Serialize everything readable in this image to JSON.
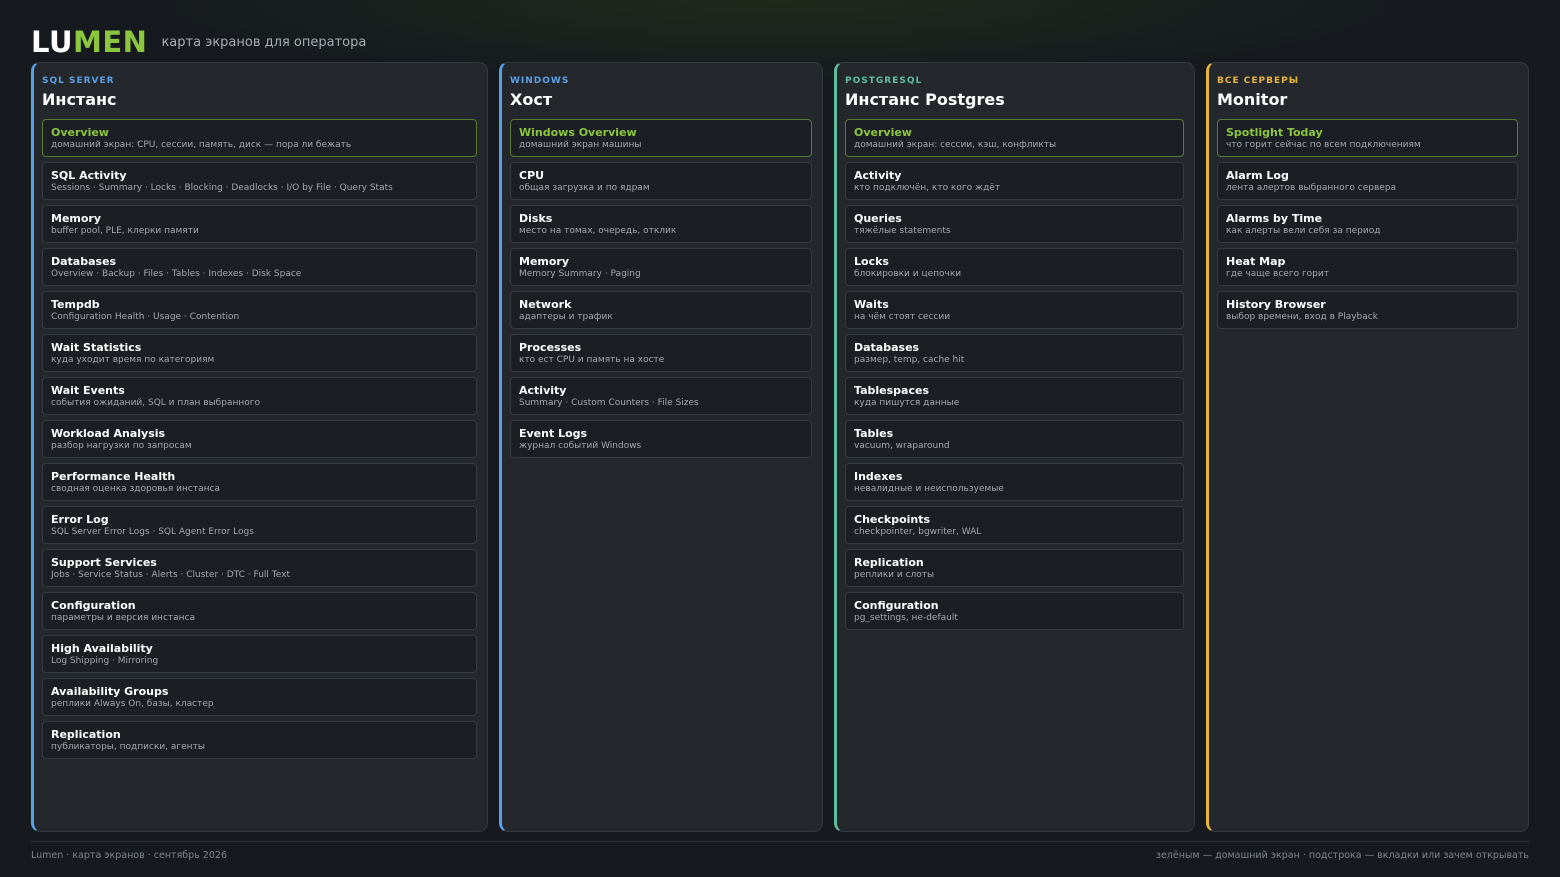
{
  "header": {
    "logo_a": "LU",
    "logo_b": "MEN",
    "subtitle": "карта экранов для оператора"
  },
  "colors": {
    "sql": "#5aa0e6",
    "windows": "#5aa0e6",
    "postgres": "#5fbf9a",
    "all": "#e6b53c",
    "home": "#8cc63f"
  },
  "panels": [
    {
      "category": "SQL SERVER",
      "title": "Инстанс",
      "items": [
        {
          "name": "Overview",
          "desc": "домашний экран: CPU, сессии, память, диск — пора ли бежать",
          "home": true
        },
        {
          "name": "SQL Activity",
          "desc": "Sessions · Summary · Locks · Blocking · Deadlocks · I/O by File · Query Stats"
        },
        {
          "name": "Memory",
          "desc": "buffer pool, PLE, клерки памяти"
        },
        {
          "name": "Databases",
          "desc": "Overview · Backup · Files · Tables · Indexes · Disk Space"
        },
        {
          "name": "Tempdb",
          "desc": "Configuration Health · Usage · Contention"
        },
        {
          "name": "Wait Statistics",
          "desc": "куда уходит время по категориям"
        },
        {
          "name": "Wait Events",
          "desc": "события ожиданий, SQL и план выбранного"
        },
        {
          "name": "Workload Analysis",
          "desc": "разбор нагрузки по запросам"
        },
        {
          "name": "Performance Health",
          "desc": "сводная оценка здоровья инстанса"
        },
        {
          "name": "Error Log",
          "desc": "SQL Server Error Logs · SQL Agent Error Logs"
        },
        {
          "name": "Support Services",
          "desc": "Jobs · Service Status · Alerts · Cluster · DTC · Full Text"
        },
        {
          "name": "Configuration",
          "desc": "параметры и версия инстанса"
        },
        {
          "name": "High Availability",
          "desc": "Log Shipping · Mirroring"
        },
        {
          "name": "Availability Groups",
          "desc": "реплики Always On, базы, кластер"
        },
        {
          "name": "Replication",
          "desc": "публикаторы, подписки, агенты"
        }
      ]
    },
    {
      "category": "WINDOWS",
      "title": "Хост",
      "items": [
        {
          "name": "Windows Overview",
          "desc": "домашний экран машины",
          "home": true
        },
        {
          "name": "CPU",
          "desc": "общая загрузка и по ядрам"
        },
        {
          "name": "Disks",
          "desc": "место на томах, очередь, отклик"
        },
        {
          "name": "Memory",
          "desc": "Memory Summary · Paging"
        },
        {
          "name": "Network",
          "desc": "адаптеры и трафик"
        },
        {
          "name": "Processes",
          "desc": "кто ест CPU и память на хосте"
        },
        {
          "name": "Activity",
          "desc": "Summary · Custom Counters · File Sizes"
        },
        {
          "name": "Event Logs",
          "desc": "журнал событий Windows"
        }
      ]
    },
    {
      "category": "POSTGRESQL",
      "title": "Инстанс Postgres",
      "items": [
        {
          "name": "Overview",
          "desc": "домашний экран: сессии, кэш, конфликты",
          "home": true
        },
        {
          "name": "Activity",
          "desc": "кто подключён, кто кого ждёт"
        },
        {
          "name": "Queries",
          "desc": "тяжёлые statements"
        },
        {
          "name": "Locks",
          "desc": "блокировки и цепочки"
        },
        {
          "name": "Waits",
          "desc": "на чём стоят сессии"
        },
        {
          "name": "Databases",
          "desc": "размер, temp, cache hit"
        },
        {
          "name": "Tablespaces",
          "desc": "куда пишутся данные"
        },
        {
          "name": "Tables",
          "desc": "vacuum, wraparound"
        },
        {
          "name": "Indexes",
          "desc": "невалидные и неиспользуемые"
        },
        {
          "name": "Checkpoints",
          "desc": "checkpointer, bgwriter, WAL"
        },
        {
          "name": "Replication",
          "desc": "реплики и слоты"
        },
        {
          "name": "Configuration",
          "desc": "pg_settings, не-default"
        }
      ]
    },
    {
      "category": "ВСЕ СЕРВЕРЫ",
      "title": "Monitor",
      "items": [
        {
          "name": "Spotlight Today",
          "desc": "что горит сейчас по всем подключениям",
          "home": true
        },
        {
          "name": "Alarm Log",
          "desc": "лента алертов выбранного сервера"
        },
        {
          "name": "Alarms by Time",
          "desc": "как алерты вели себя за период"
        },
        {
          "name": "Heat Map",
          "desc": "где чаще всего горит"
        },
        {
          "name": "History Browser",
          "desc": "выбор времени, вход в Playback"
        }
      ]
    }
  ],
  "footer": {
    "left": "Lumen · карта экранов · сентябрь 2026",
    "right": "зелёным — домашний экран · подстрока — вкладки или зачем открывать"
  }
}
